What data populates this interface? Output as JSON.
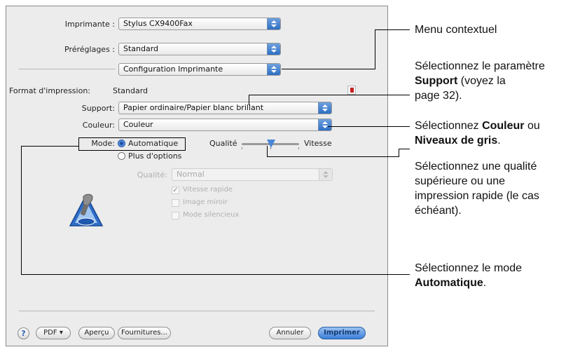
{
  "dialog": {
    "printer_label": "Imprimante :",
    "printer_value": "Stylus CX9400Fax",
    "presets_label": "Préréglages :",
    "presets_value": "Standard",
    "panel_value": "Configuration Imprimante",
    "paper_size_label": "Format d'impression:",
    "paper_size_value": "Standard",
    "media_label": "Support:",
    "media_value": "Papier ordinaire/Papier blanc brillant",
    "color_label": "Couleur:",
    "color_value": "Couleur",
    "mode_label": "Mode:",
    "mode_auto": "Automatique",
    "mode_more": "Plus d'options",
    "quality_slider_label": "Qualité",
    "speed_label": "Vitesse",
    "quality_label": "Qualité:",
    "quality_value": "Normal",
    "opt_fast": "Vitesse rapide",
    "opt_mirror": "Image miroir",
    "opt_silent": "Mode silencieux",
    "help": "?",
    "pdf_button": "PDF ▾",
    "preview_button": "Aperçu",
    "supplies_button": "Fournitures...",
    "cancel_button": "Annuler",
    "print_button": "Imprimer"
  },
  "callouts": {
    "menu": "Menu contextuel",
    "support_1": "Sélectionnez le paramètre",
    "support_bold": "Support",
    "support_2": " (voyez la",
    "support_3": "page 32).",
    "color_1": "Sélectionnez ",
    "color_bold1": "Couleur",
    "color_2": " ou",
    "color_bold2": "Niveaux de gris",
    "color_3": ".",
    "quality_1": "Sélectionnez une qualité",
    "quality_2": "supérieure ou une",
    "quality_3": "impression rapide (le cas",
    "quality_4": "échéant).",
    "mode_1": "Sélectionnez le mode",
    "mode_bold": "Automatique",
    "mode_2": "."
  }
}
